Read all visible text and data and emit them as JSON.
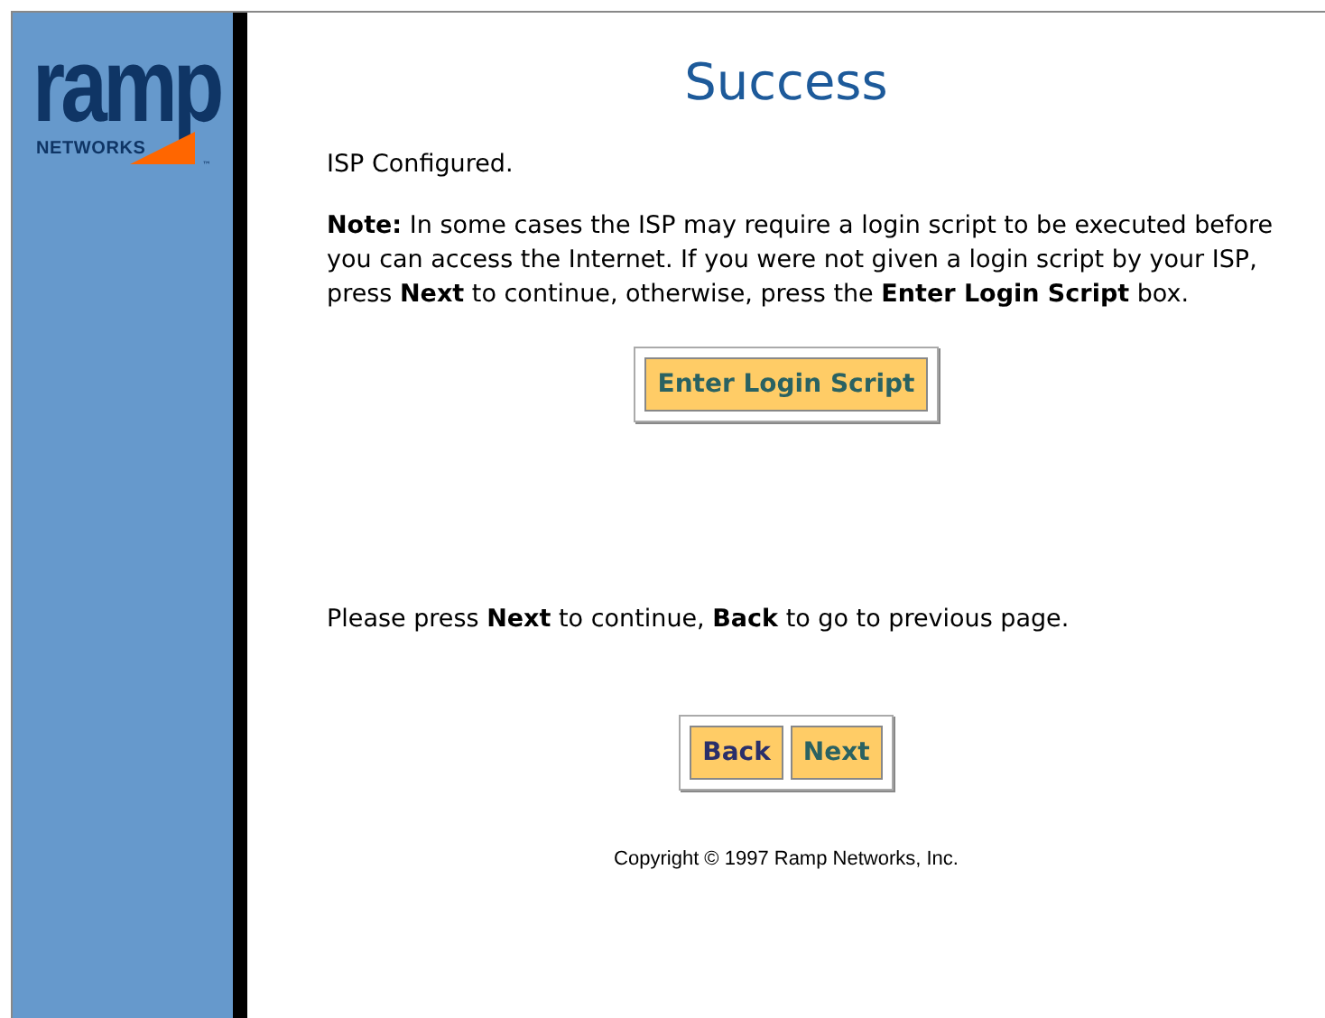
{
  "logo": {
    "word": "ramp",
    "sub": "NETWORKS",
    "trademark": "™"
  },
  "title": "Success",
  "status": "ISP Configured.",
  "note": "**Note:** In some cases the ISP may require a login script to be executed before you can access the Internet. If you were not given a login script by your ISP, press **Next** to continue, otherwise, press the **Enter Login Script** box.",
  "script_button": "Enter Login Script",
  "instruction": "Please press **Next** to continue, **Back** to go to previous page.",
  "nav_buttons": [
    {
      "label": "Back",
      "kind": "back"
    },
    {
      "label": "Next",
      "kind": "next"
    }
  ],
  "copyright": "Copyright © 1997 Ramp Networks, Inc."
}
